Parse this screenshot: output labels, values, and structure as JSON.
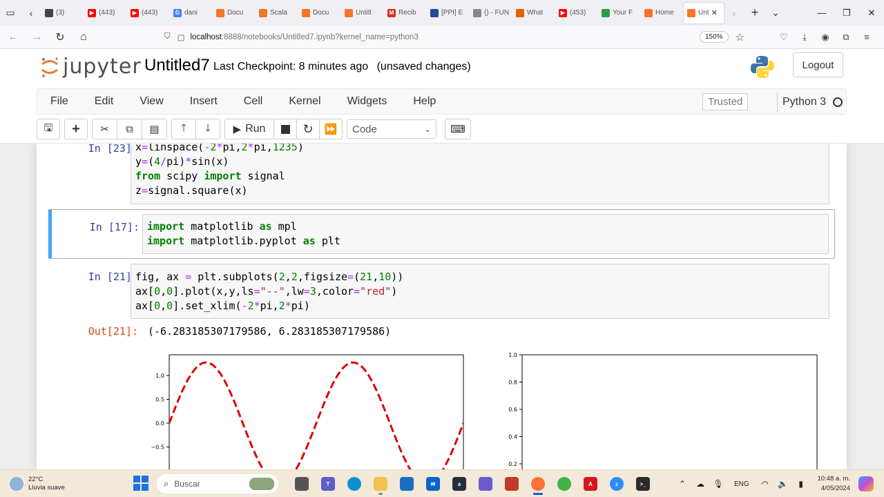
{
  "browser": {
    "tabs": [
      {
        "label": "(3)",
        "fav_color": "#444444",
        "fav_glyph": ""
      },
      {
        "label": "(443)",
        "fav_color": "#ff0000",
        "fav_glyph": "▶"
      },
      {
        "label": "(443)",
        "fav_color": "#ff0000",
        "fav_glyph": "▶"
      },
      {
        "label": "dani",
        "fav_color": "#4285f4",
        "fav_glyph": "G"
      },
      {
        "label": "Docu",
        "fav_color": "#f37626",
        "fav_glyph": ""
      },
      {
        "label": "Scala",
        "fav_color": "#f37626",
        "fav_glyph": ""
      },
      {
        "label": "Docu",
        "fav_color": "#f37626",
        "fav_glyph": ""
      },
      {
        "label": "Untitl",
        "fav_color": "#f37626",
        "fav_glyph": ""
      },
      {
        "label": "Recib",
        "fav_color": "#d93025",
        "fav_glyph": "M"
      },
      {
        "label": "[PPI] E",
        "fav_color": "#1e4e8c",
        "fav_glyph": ""
      },
      {
        "label": "() - FUNDA",
        "fav_color": "#888888",
        "fav_glyph": ""
      },
      {
        "label": "What",
        "fav_color": "#e66000",
        "fav_glyph": ""
      },
      {
        "label": "(453)",
        "fav_color": "#ff0000",
        "fav_glyph": "▶"
      },
      {
        "label": "Your F",
        "fav_color": "#2e9e46",
        "fav_glyph": ""
      },
      {
        "label": "Home",
        "fav_color": "#f37626",
        "fav_glyph": ""
      },
      {
        "label": "Unt",
        "fav_color": "#f37626",
        "fav_glyph": "",
        "active": true
      }
    ],
    "url_host": "localhost",
    "url_rest": ":8888/notebooks/Untitled7.ipynb?kernel_name=python3",
    "zoom": "150%"
  },
  "jupyter": {
    "logo_text": "jupyter",
    "notebook_name": "Untitled7",
    "checkpoint": "Last Checkpoint: 8 minutes ago",
    "unsaved": "(unsaved changes)",
    "logout": "Logout",
    "menu": [
      "File",
      "Edit",
      "View",
      "Insert",
      "Cell",
      "Kernel",
      "Widgets",
      "Help"
    ],
    "trusted": "Trusted",
    "kernel_name": "Python 3",
    "toolbar": {
      "run_label": "Run",
      "cell_type": "Code"
    }
  },
  "cells": [
    {
      "prompt": "In [23]:",
      "lines": [
        "x=linspace(-2*pi,2*pi,1235)",
        "y=(4/pi)*sin(x)",
        "from scipy import signal",
        "z=signal.square(x)"
      ]
    },
    {
      "prompt": "In [17]:",
      "lines": [
        "import matplotlib as mpl",
        "import matplotlib.pyplot as plt"
      ]
    },
    {
      "prompt": "In [21]:",
      "lines": [
        "fig, ax = plt.subplots(2,2,figsize=(21,10))",
        "ax[0,0].plot(x,y,ls=\"--\",lw=3,color=\"red\")",
        "ax[0,0].set_xlim(-2*pi,2*pi)"
      ]
    }
  ],
  "output": {
    "prompt": "Out[21]:",
    "text": "(-6.283185307179586, 6.283185307179586)"
  },
  "chart_data": [
    {
      "type": "line",
      "series": [
        {
          "color": "#dd0000",
          "linestyle": "dashed",
          "function": "(4/pi)*sin(x)"
        }
      ],
      "xlim": [
        -6.283185307179586,
        6.283185307179586
      ],
      "yticks": [
        1.0,
        0.5,
        0.0,
        -0.5
      ],
      "ytick_labels": [
        "1.0",
        "0.5",
        "0.0",
        "−0.5"
      ],
      "ylim_visible": [
        -0.7,
        1.4
      ]
    },
    {
      "type": "line",
      "series": [],
      "yticks": [
        1.0,
        0.8,
        0.6,
        0.4,
        0.2
      ],
      "ytick_labels": [
        "1.0",
        "0.8",
        "0.6",
        "0.4",
        "0.2"
      ],
      "ylim_visible": [
        0.2,
        1.0
      ]
    }
  ],
  "taskbar": {
    "temp": "22°C",
    "weather": "Lluvia suave",
    "search_placeholder": "Buscar",
    "lang": "ENG",
    "time": "10:48 a. m.",
    "date": "4/05/2024"
  }
}
